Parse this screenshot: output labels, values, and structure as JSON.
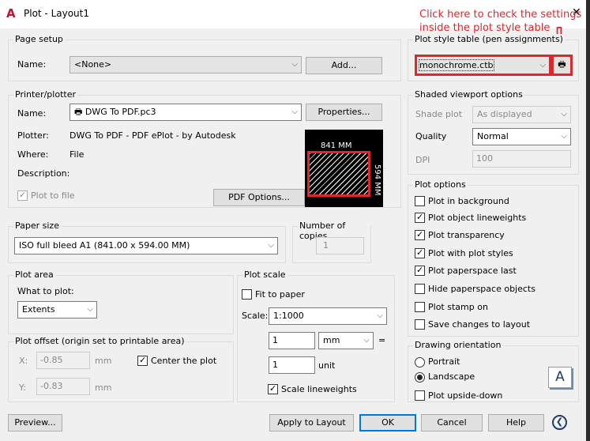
{
  "window": {
    "title": "Plot - Layout1",
    "close": "✕"
  },
  "annotation": {
    "line1": "Click here to check the settings",
    "line2": "inside the plot style table",
    "color": "#e0262b"
  },
  "page_setup": {
    "label": "Page setup",
    "name_label": "Name:",
    "name_value": "<None>",
    "add_button": "Add..."
  },
  "plot_style": {
    "label": "Plot style table (pen assignments)",
    "value": "monochrome.ctb",
    "edit_icon": "edit-plot-style-icon"
  },
  "printer": {
    "label": "Printer/plotter",
    "name_label": "Name:",
    "name_value": "DWG To PDF.pc3",
    "properties_button": "Properties...",
    "plotter_label": "Plotter:",
    "plotter_value": "DWG To PDF - PDF ePlot - by Autodesk",
    "where_label": "Where:",
    "where_value": "File",
    "description_label": "Description:",
    "plot_to_file": "Plot to file",
    "pdf_options_button": "PDF Options...",
    "preview_width": "841 MM",
    "preview_height": "594 MM"
  },
  "shaded": {
    "label": "Shaded viewport options",
    "shade_label": "Shade plot",
    "shade_value": "As displayed",
    "quality_label": "Quality",
    "quality_value": "Normal",
    "dpi_label": "DPI",
    "dpi_value": "100"
  },
  "paper_size": {
    "label": "Paper size",
    "value": "ISO full bleed A1 (841.00 x 594.00 MM)"
  },
  "copies": {
    "label": "Number of copies",
    "value": "1"
  },
  "plot_options": {
    "label": "Plot options",
    "items": [
      {
        "label": "Plot in background",
        "checked": false
      },
      {
        "label": "Plot object lineweights",
        "checked": true
      },
      {
        "label": "Plot transparency",
        "checked": true
      },
      {
        "label": "Plot with plot styles",
        "checked": true
      },
      {
        "label": "Plot paperspace last",
        "checked": true
      },
      {
        "label": "Hide paperspace objects",
        "checked": false
      },
      {
        "label": "Plot stamp on",
        "checked": false
      },
      {
        "label": "Save changes to layout",
        "checked": false
      }
    ]
  },
  "plot_area": {
    "label": "Plot area",
    "what_label": "What to plot:",
    "what_value": "Extents"
  },
  "plot_scale": {
    "label": "Plot scale",
    "fit_to_paper": "Fit to paper",
    "scale_label": "Scale:",
    "scale_value": "1:1000",
    "value1": "1",
    "unit1": "mm",
    "equals": "=",
    "value2": "1",
    "unit2": "unit",
    "scale_lineweights": "Scale lineweights"
  },
  "plot_offset": {
    "label": "Plot offset (origin set to printable area)",
    "x_label": "X:",
    "x_value": "-0.85",
    "y_label": "Y:",
    "y_value": "-0.83",
    "unit": "mm",
    "center": "Center the plot"
  },
  "orientation": {
    "label": "Drawing orientation",
    "portrait": "Portrait",
    "landscape": "Landscape",
    "upside_down": "Plot upside-down",
    "icon_letter": "A"
  },
  "buttons": {
    "preview": "Preview...",
    "apply": "Apply to Layout",
    "ok": "OK",
    "cancel": "Cancel",
    "help": "Help"
  }
}
